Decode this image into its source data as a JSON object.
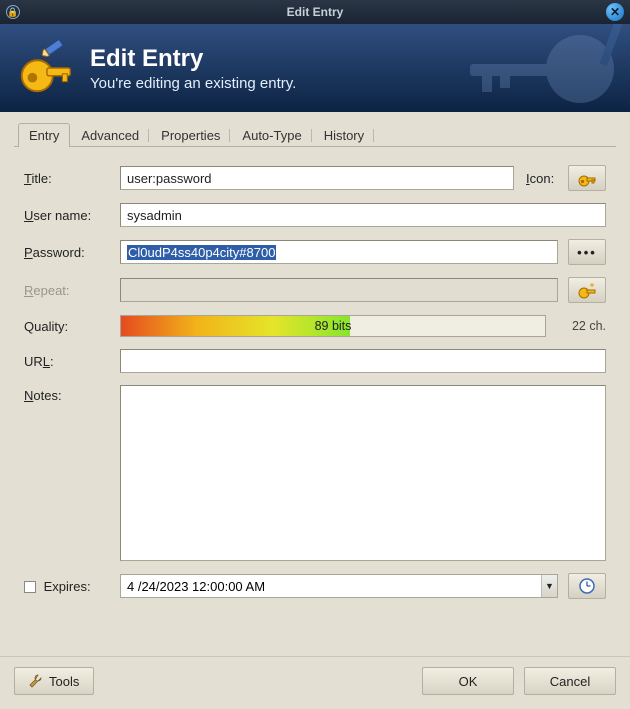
{
  "window": {
    "title": "Edit Entry"
  },
  "banner": {
    "heading": "Edit Entry",
    "subtitle": "You're editing an existing entry."
  },
  "tabs": [
    {
      "label": "Entry",
      "active": true
    },
    {
      "label": "Advanced",
      "active": false
    },
    {
      "label": "Properties",
      "active": false
    },
    {
      "label": "Auto-Type",
      "active": false
    },
    {
      "label": "History",
      "active": false
    }
  ],
  "labels": {
    "title": "Title:",
    "icon": "Icon:",
    "username": "User name:",
    "password": "Password:",
    "repeat": "Repeat:",
    "quality": "Quality:",
    "url": "URL:",
    "notes": "Notes:",
    "expires": "Expires:"
  },
  "fields": {
    "title": "user:password",
    "username": "sysadmin",
    "password": "Cl0udP4ss40p4city#8700",
    "repeat": "",
    "url": "",
    "notes": "",
    "expires_checked": false,
    "expires": "4 /24/2023 12:00:00 AM"
  },
  "quality": {
    "bits_text": "89 bits",
    "chars_text": "22 ch."
  },
  "buttons": {
    "tools": "Tools",
    "ok": "OK",
    "cancel": "Cancel",
    "dots": "•••"
  }
}
